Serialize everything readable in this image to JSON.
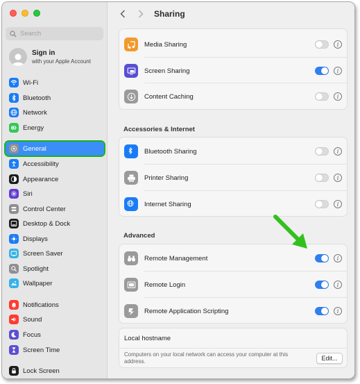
{
  "window": {
    "title": "Sharing"
  },
  "search": {
    "placeholder": "Search"
  },
  "account": {
    "title": "Sign in",
    "subtitle": "with your Apple Account"
  },
  "sidebar": {
    "items": [
      {
        "label": "Wi-Fi",
        "icon": "wifi-icon",
        "color": "#1a7cf5"
      },
      {
        "label": "Bluetooth",
        "icon": "bluetooth-icon",
        "color": "#1a7cf5"
      },
      {
        "label": "Network",
        "icon": "globe-icon",
        "color": "#1a7cf5"
      },
      {
        "label": "Energy",
        "icon": "battery-icon",
        "color": "#34c759"
      },
      {
        "label": "General",
        "icon": "gear-icon",
        "color": "#8e8e93",
        "selected": true
      },
      {
        "label": "Accessibility",
        "icon": "accessibility-icon",
        "color": "#1a7cf5"
      },
      {
        "label": "Appearance",
        "icon": "appearance-icon",
        "color": "#1c1c1e"
      },
      {
        "label": "Siri",
        "icon": "siri-icon",
        "color": "#5b3fd1"
      },
      {
        "label": "Control Center",
        "icon": "control-center-icon",
        "color": "#8e8e93"
      },
      {
        "label": "Desktop & Dock",
        "icon": "dock-icon",
        "color": "#1c1c1e"
      },
      {
        "label": "Displays",
        "icon": "displays-icon",
        "color": "#1a7cf5"
      },
      {
        "label": "Screen Saver",
        "icon": "screensaver-icon",
        "color": "#35b3e8"
      },
      {
        "label": "Spotlight",
        "icon": "spotlight-icon",
        "color": "#8e8e93"
      },
      {
        "label": "Wallpaper",
        "icon": "wallpaper-icon",
        "color": "#35b3e8"
      },
      {
        "label": "Notifications",
        "icon": "bell-icon",
        "color": "#ff3b30"
      },
      {
        "label": "Sound",
        "icon": "speaker-icon",
        "color": "#ff3b30"
      },
      {
        "label": "Focus",
        "icon": "moon-icon",
        "color": "#5b4fd1"
      },
      {
        "label": "Screen Time",
        "icon": "hourglass-icon",
        "color": "#5b4fd1"
      },
      {
        "label": "Lock Screen",
        "icon": "lock-icon",
        "color": "#1c1c1e"
      }
    ]
  },
  "sections": {
    "top": [
      {
        "label": "Media Sharing",
        "icon": "media-sharing-icon",
        "color": "#f19a2d",
        "enabled": false
      },
      {
        "label": "Screen Sharing",
        "icon": "screen-sharing-icon",
        "color": "#5a4fd1",
        "enabled": true
      },
      {
        "label": "Content Caching",
        "icon": "content-caching-icon",
        "color": "#9a9a9a",
        "enabled": false
      }
    ],
    "accessories": {
      "title": "Accessories & Internet",
      "rows": [
        {
          "label": "Bluetooth Sharing",
          "icon": "bluetooth-icon",
          "color": "#1a7cf5",
          "enabled": false
        },
        {
          "label": "Printer Sharing",
          "icon": "printer-icon",
          "color": "#9a9a9a",
          "enabled": false
        },
        {
          "label": "Internet Sharing",
          "icon": "globe-icon",
          "color": "#1a7cf5",
          "enabled": false
        }
      ]
    },
    "advanced": {
      "title": "Advanced",
      "rows": [
        {
          "label": "Remote Management",
          "icon": "binoculars-icon",
          "color": "#9a9a9a",
          "enabled": true
        },
        {
          "label": "Remote Login",
          "icon": "remote-login-icon",
          "color": "#9a9a9a",
          "enabled": true
        },
        {
          "label": "Remote Application Scripting",
          "icon": "scripting-icon",
          "color": "#9a9a9a",
          "enabled": true
        }
      ]
    },
    "hostname": {
      "title": "Local hostname",
      "description": "Computers on your local network can access your computer at this address.",
      "button": "Edit..."
    }
  },
  "info_glyph": "i"
}
